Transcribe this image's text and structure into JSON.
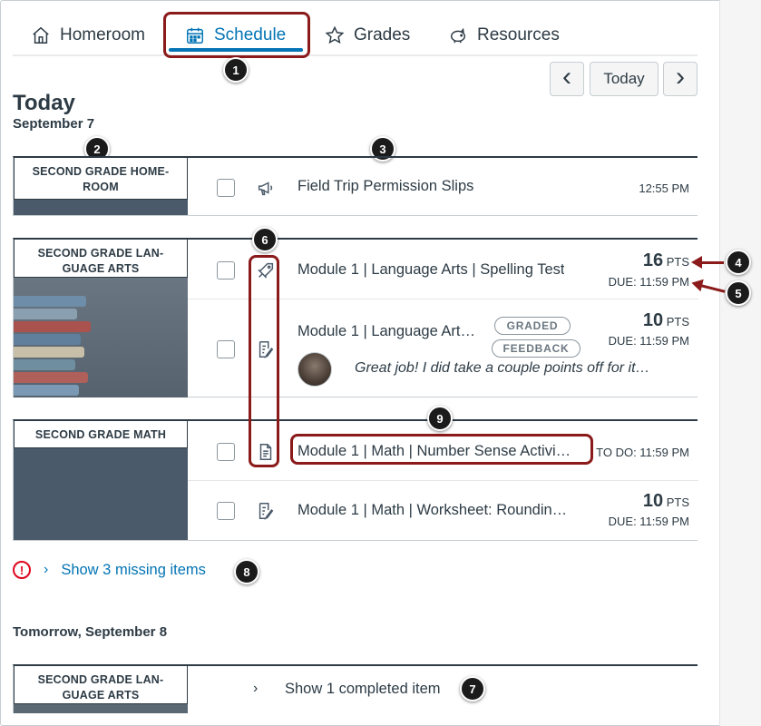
{
  "tabs": [
    {
      "label": "Homeroom",
      "icon": "home-icon"
    },
    {
      "label": "Schedule",
      "icon": "calendar-icon"
    },
    {
      "label": "Grades",
      "icon": "star-icon"
    },
    {
      "label": "Resources",
      "icon": "piggy-bank-icon"
    }
  ],
  "nav": {
    "prev": "‹",
    "today": "Today",
    "next": "›"
  },
  "today": {
    "title": "Today",
    "date": "September 7"
  },
  "groups": [
    {
      "course": "SECOND GRADE HOME-ROOM",
      "items": [
        {
          "icon": "announcement-icon",
          "title": "Field Trip Permission Slips",
          "time": "12:55 PM"
        }
      ]
    },
    {
      "course": "SECOND GRADE LAN-GUAGE ARTS",
      "items": [
        {
          "icon": "quiz-icon",
          "title": "Module 1 | Language Arts | Spelling Test",
          "points": "16",
          "points_label": "PTS",
          "due": "DUE: 11:59 PM"
        },
        {
          "icon": "assignment-icon",
          "title": "Module 1 | Language Art…",
          "pill_graded": "GRADED",
          "pill_feedback": "FEEDBACK",
          "points": "10",
          "points_label": "PTS",
          "due": "DUE: 11:59 PM",
          "feedback": "Great job! I did take a couple points off for it…"
        }
      ]
    },
    {
      "course": "SECOND GRADE MATH",
      "items": [
        {
          "icon": "page-icon",
          "title": "Module 1 | Math | Number Sense Activi…",
          "todo": "TO DO: 11:59 PM"
        },
        {
          "icon": "assignment-icon",
          "title": "Module 1 | Math | Worksheet: Roundin…",
          "points": "10",
          "points_label": "PTS",
          "due": "DUE: 11:59 PM"
        }
      ]
    }
  ],
  "missing": {
    "text": "Show 3 missing items",
    "chevron": "›",
    "alert": "!"
  },
  "tomorrow": {
    "date": "Tomorrow, September 8",
    "course": "SECOND GRADE LAN-GUAGE ARTS",
    "completed_text": "Show 1 completed item",
    "chevron": "›"
  },
  "callouts": [
    "1",
    "2",
    "3",
    "4",
    "5",
    "6",
    "7",
    "8",
    "9"
  ],
  "colors": {
    "accent": "#0374b5",
    "callout": "#8b1a1a",
    "alert": "#e0061f",
    "text": "#2d3b45"
  }
}
